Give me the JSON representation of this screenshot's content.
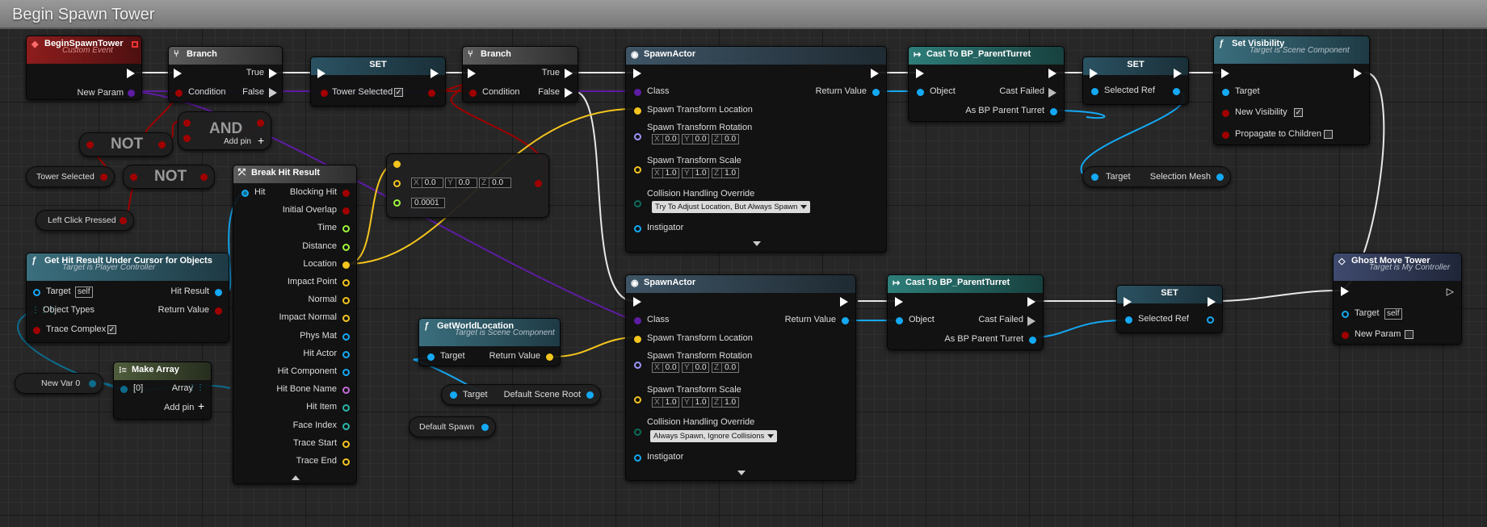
{
  "graph": {
    "title": "Begin Spawn Tower"
  },
  "colors": {
    "exec": "#ffffff",
    "bool": "#a10000",
    "object": "#14a9f4",
    "class": "#5e1ca3",
    "vector": "#f4c51e",
    "struct": "#0d6b8c",
    "float": "#9ef53b",
    "transform": "#f28b1c"
  },
  "nodes": {
    "begin_spawn_tower": {
      "title": "BeginSpawnTower",
      "subtitle": "Custom Event",
      "pin_new_param": "New Param"
    },
    "branch1": {
      "title": "Branch",
      "true": "True",
      "false": "False",
      "condition": "Condition"
    },
    "set_tower_selected": {
      "title": "SET",
      "pin": "Tower Selected",
      "checked": true
    },
    "branch2": {
      "title": "Branch",
      "true": "True",
      "false": "False",
      "condition": "Condition"
    },
    "and": {
      "label": "AND",
      "add_pin": "Add pin"
    },
    "not1": {
      "label": "NOT"
    },
    "not2": {
      "label": "NOT"
    },
    "tower_selected_var": {
      "label": "Tower Selected"
    },
    "left_click": {
      "label": "Left Click Pressed"
    },
    "make_vector": {
      "x": "0.0",
      "y": "0.0",
      "z": "0.0",
      "tolerance": "0.0001",
      "x_label": "X",
      "y_label": "Y",
      "z_label": "Z"
    },
    "break_hit": {
      "title": "Break Hit Result",
      "input": "Hit",
      "outputs": [
        "Blocking Hit",
        "Initial Overlap",
        "Time",
        "Distance",
        "Location",
        "Impact Point",
        "Normal",
        "Impact Normal",
        "Phys Mat",
        "Hit Actor",
        "Hit Component",
        "Hit Bone Name",
        "Hit Item",
        "Face Index",
        "Trace Start",
        "Trace End"
      ]
    },
    "get_hit": {
      "title": "Get Hit Result Under Cursor for Objects",
      "subtitle": "Target is Player Controller",
      "target": "Target",
      "self": "self",
      "object_types": "Object Types",
      "trace_complex": "Trace Complex",
      "hit_result": "Hit Result",
      "return_value": "Return Value"
    },
    "new_var0": {
      "label": "New Var 0"
    },
    "make_array": {
      "title": "Make Array",
      "index": "[0]",
      "array": "Array",
      "add_pin": "Add pin"
    },
    "spawn1": {
      "title": "SpawnActor",
      "class": "Class",
      "return_value": "Return Value",
      "loc": "Spawn Transform Location",
      "rot": "Spawn Transform Rotation",
      "scale": "Spawn Transform Scale",
      "collision": "Collision Handling Override",
      "collision_value": "Try To Adjust Location, But Always Spawn",
      "instigator": "Instigator",
      "rot_vals": [
        "0.0",
        "0.0",
        "0.0"
      ],
      "scale_vals": [
        "1.0",
        "1.0",
        "1.0"
      ]
    },
    "spawn2": {
      "title": "SpawnActor",
      "class": "Class",
      "return_value": "Return Value",
      "loc": "Spawn Transform Location",
      "rot": "Spawn Transform Rotation",
      "scale": "Spawn Transform Scale",
      "collision": "Collision Handling Override",
      "collision_value": "Always Spawn, Ignore Collisions",
      "instigator": "Instigator",
      "rot_vals": [
        "0.0",
        "0.0",
        "0.0"
      ],
      "scale_vals": [
        "1.0",
        "1.0",
        "1.0"
      ]
    },
    "cast1": {
      "title": "Cast To BP_ParentTurret",
      "object": "Object",
      "cast_failed": "Cast Failed",
      "as": "As BP Parent Turret"
    },
    "cast2": {
      "title": "Cast To BP_ParentTurret",
      "object": "Object",
      "cast_failed": "Cast Failed",
      "as": "As BP Parent Turret"
    },
    "set_ref1": {
      "title": "SET",
      "pin": "Selected Ref"
    },
    "set_ref2": {
      "title": "SET",
      "pin": "Selected Ref"
    },
    "set_visibility": {
      "title": "Set Visibility",
      "subtitle": "Target is Scene Component",
      "target": "Target",
      "new_visibility": "New Visibility",
      "new_visibility_checked": true,
      "propagate": "Propagate to Children"
    },
    "selection_mesh": {
      "target": "Target",
      "label": "Selection Mesh"
    },
    "get_world_location": {
      "title": "GetWorldLocation",
      "subtitle": "Target is Scene Component",
      "target": "Target",
      "return_value": "Return Value"
    },
    "default_scene_root": {
      "target": "Target",
      "label": "Default Scene Root"
    },
    "default_spawn": {
      "label": "Default Spawn"
    },
    "ghost_move": {
      "title": "Ghost Move Tower",
      "subtitle": "Target is My Controller",
      "target": "Target",
      "self": "self",
      "new_param": "New Param"
    }
  }
}
